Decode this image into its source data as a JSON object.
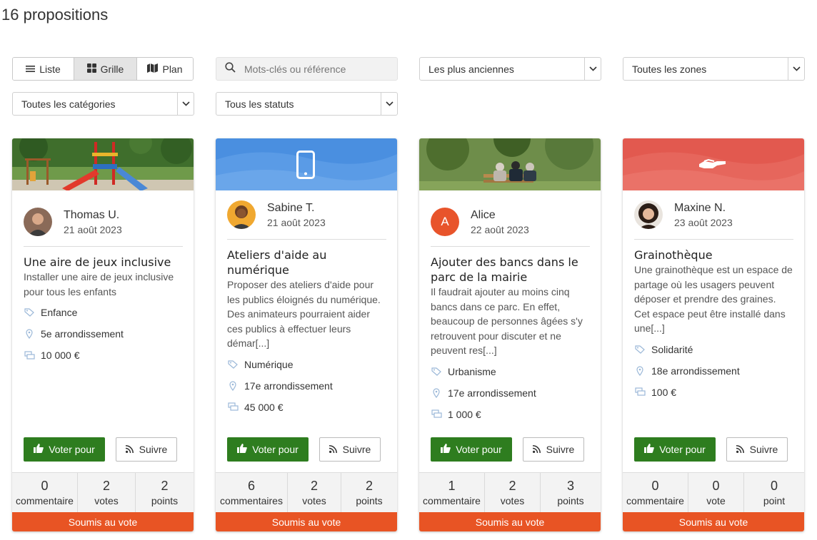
{
  "page": {
    "title": "16 propositions"
  },
  "view_toggle": [
    {
      "label": "Liste",
      "icon": "list-icon",
      "active": false
    },
    {
      "label": "Grille",
      "icon": "grid-icon",
      "active": true
    },
    {
      "label": "Plan",
      "icon": "map-icon",
      "active": false
    }
  ],
  "search": {
    "placeholder": "Mots-clés ou référence",
    "value": ""
  },
  "filters": {
    "sort": "Les plus anciennes",
    "zones": "Toutes les zones",
    "categories": "Toutes les catégories",
    "statuses": "Tous les statuts"
  },
  "colors": {
    "vote_button": "#2e7d1f",
    "status_bar": "#e85424",
    "digital_header": "#4a8fe0",
    "solidarity_header": "#e2594f",
    "alice_avatar": "#e8542b"
  },
  "cards": [
    {
      "header": "playground-photo",
      "author": "Thomas U.",
      "date": "21 août 2023",
      "title": "Une aire de jeux inclusive",
      "description": "Installer une aire de jeux inclusive pour tous les enfants",
      "category": "Enfance",
      "zone": "5e arrondissement",
      "budget": "10 000 €",
      "vote_label": "Voter pour",
      "follow_label": "Suivre",
      "stats": [
        {
          "num": "0",
          "label": "commentaire"
        },
        {
          "num": "2",
          "label": "votes"
        },
        {
          "num": "2",
          "label": "points"
        }
      ],
      "status": "Soumis au vote"
    },
    {
      "header": "phone-icon",
      "author": "Sabine T.",
      "date": "21 août 2023",
      "title": "Ateliers d'aide au numérique",
      "description": "Proposer des ateliers d'aide pour les publics éloignés du numérique. Des animateurs pourraient aider ces publics à effectuer leurs démar[...]",
      "category": "Numérique",
      "zone": "17e arrondissement",
      "budget": "45 000 €",
      "vote_label": "Voter pour",
      "follow_label": "Suivre",
      "stats": [
        {
          "num": "6",
          "label": "commentaires"
        },
        {
          "num": "2",
          "label": "votes"
        },
        {
          "num": "2",
          "label": "points"
        }
      ],
      "status": "Soumis au vote"
    },
    {
      "header": "park-bench-photo",
      "author": "Alice",
      "avatar_letter": "A",
      "date": "22 août 2023",
      "title": "Ajouter des bancs dans le parc de la mairie",
      "description": "Il faudrait ajouter au moins cinq bancs dans ce parc. En effet, beaucoup de personnes âgées s'y retrouvent pour discuter et ne peuvent res[...]",
      "category": "Urbanisme",
      "zone": "17e arrondissement",
      "budget": "1 000 €",
      "vote_label": "Voter pour",
      "follow_label": "Suivre",
      "stats": [
        {
          "num": "1",
          "label": "commentaire"
        },
        {
          "num": "2",
          "label": "votes"
        },
        {
          "num": "3",
          "label": "points"
        }
      ],
      "status": "Soumis au vote"
    },
    {
      "header": "helping-hand-icon",
      "author": "Maxine N.",
      "date": "23 août 2023",
      "title": "Grainothèque",
      "description": "Une grainothèque est un espace de partage où les usagers peuvent déposer et prendre des graines. Cet espace peut être installé dans une[...]",
      "category": "Solidarité",
      "zone": "18e arrondissement",
      "budget": "100 €",
      "vote_label": "Voter pour",
      "follow_label": "Suivre",
      "stats": [
        {
          "num": "0",
          "label": "commentaire"
        },
        {
          "num": "0",
          "label": "vote"
        },
        {
          "num": "0",
          "label": "point"
        }
      ],
      "status": "Soumis au vote"
    }
  ]
}
